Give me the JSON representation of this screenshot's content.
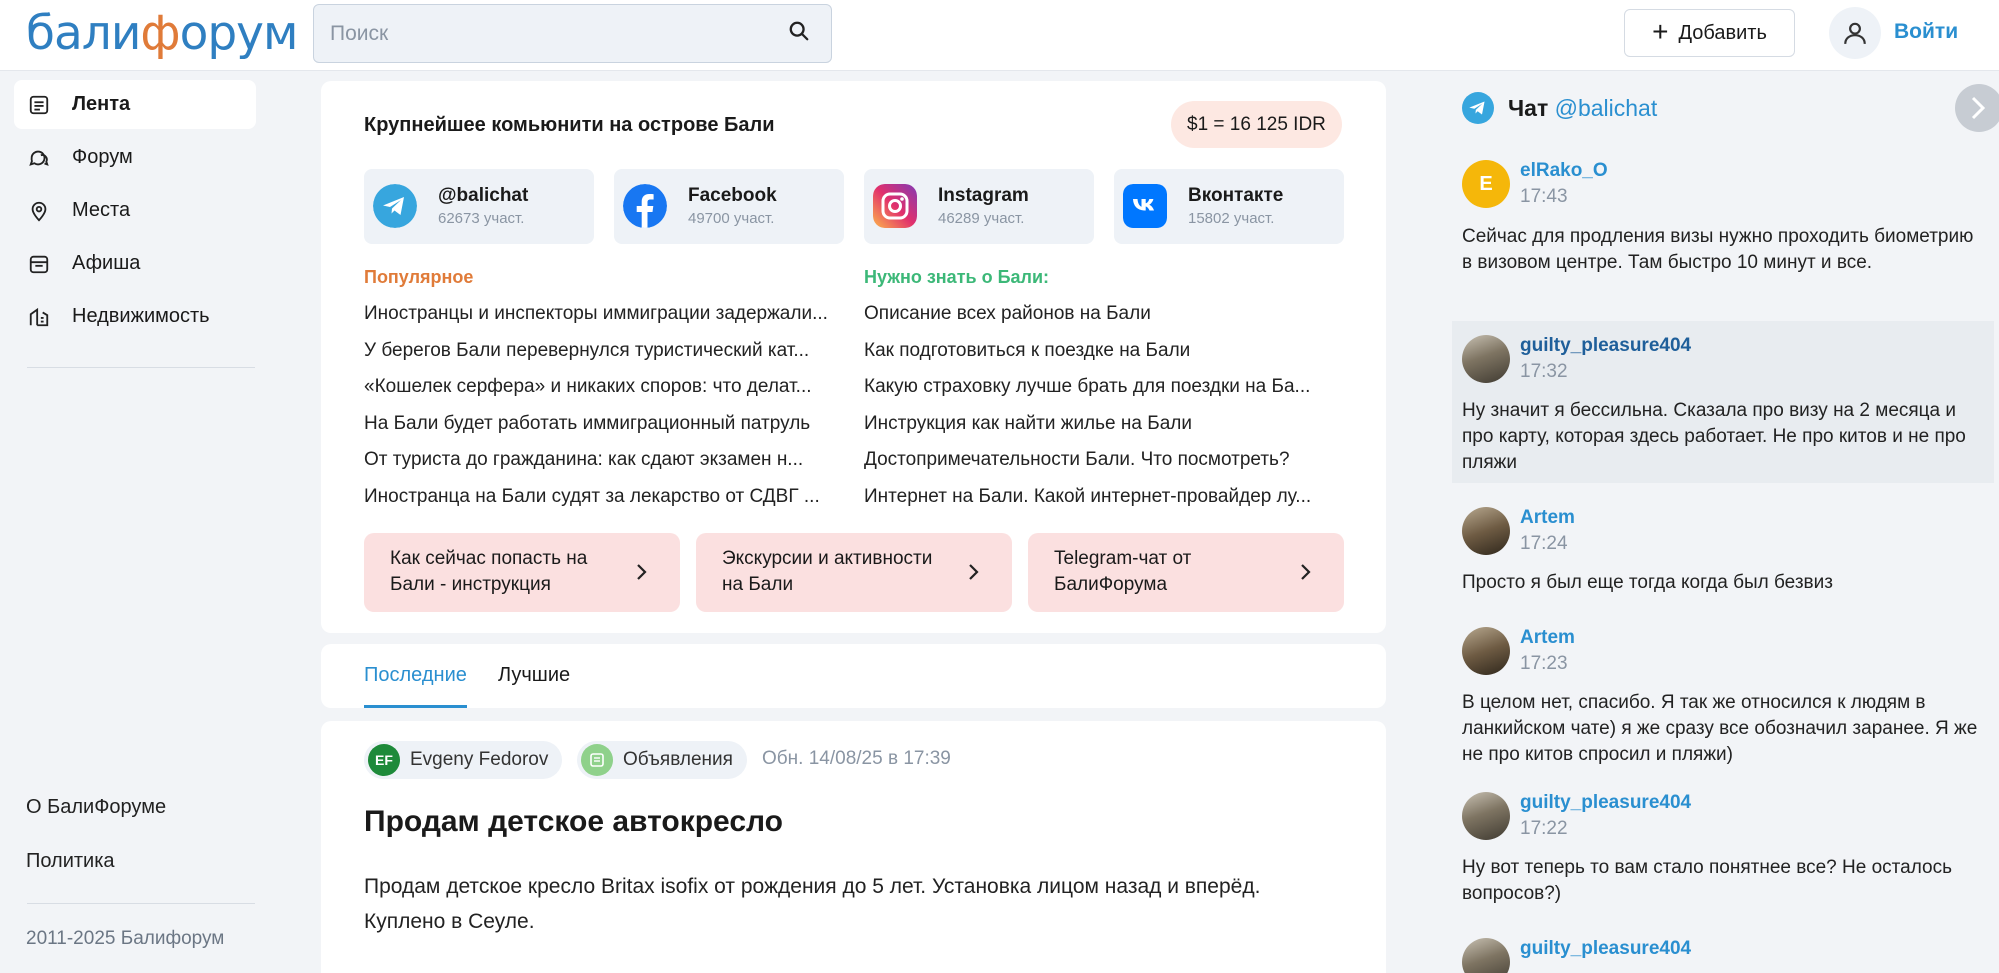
{
  "header": {
    "logo": {
      "part1": "бали",
      "part2": "ф",
      "part3": "орум"
    },
    "search_placeholder": "Поиск",
    "add_label": "Добавить",
    "login_label": "Войти"
  },
  "sidebar": {
    "items": [
      {
        "label": "Лента",
        "icon": "feed-icon",
        "active": true
      },
      {
        "label": "Форум",
        "icon": "chat-bubbles-icon"
      },
      {
        "label": "Места",
        "icon": "map-pin-icon"
      },
      {
        "label": "Афиша",
        "icon": "calendar-icon"
      },
      {
        "label": "Недвижимость",
        "icon": "building-icon"
      }
    ],
    "about": "О БалиФоруме",
    "policy": "Политика",
    "copyright": "2011-2025 Балифорум"
  },
  "community": {
    "title": "Крупнейшее комьюнити на острове Бали",
    "rate": "$1 = 16 125 IDR",
    "socials": [
      {
        "name": "@balichat",
        "count": "62673 участ.",
        "icon": "telegram-icon",
        "color": "#37a6de"
      },
      {
        "name": "Facebook",
        "count": "49700 участ.",
        "icon": "facebook-icon",
        "color": "#1877f2"
      },
      {
        "name": "Instagram",
        "count": "46289 участ.",
        "icon": "instagram-icon",
        "color": "#d6249f"
      },
      {
        "name": "Вконтакте",
        "count": "15802 участ.",
        "icon": "vk-icon",
        "color": "#0077ff"
      }
    ],
    "popular_title": "Популярное",
    "popular": [
      "Иностранцы и инспекторы иммиграции задержали...",
      "У берегов Бали перевернулся туристический кат...",
      "«Кошелек серфера» и никаких споров: что делат...",
      "На Бали будет работать иммиграционный патруль",
      "От туриста до гражданина: как сдают экзамен н...",
      "Иностранца на Бали судят за лекарство от СДВГ ..."
    ],
    "know_title": "Нужно знать о Бали:",
    "know": [
      "Описание всех районов на Бали",
      "Как подготовиться к поездке на Бали",
      "Какую страховку лучше брать для поездки на Ба...",
      "Инструкция как найти жилье на Бали",
      "Достопримечательности Бали. Что посмотреть?",
      "Интернет на Бали. Какой интернет-провайдер лу..."
    ],
    "promos": [
      "Как сейчас попасть на Бали - инструкция",
      "Экскурсии и активности на Бали",
      "Telegram-чат от БалиФорума"
    ]
  },
  "tabs": {
    "latest": "Последние",
    "best": "Лучшие"
  },
  "post": {
    "author_initials": "EF",
    "author": "Evgeny Fedorov",
    "category": "Объявления",
    "updated": "Обн. 14/08/25 в 17:39",
    "title": "Продам детское автокресло",
    "body": "Продам детское кресло Britax isofix от рождения до 5 лет. Установка лицом назад и вперёд. Куплено в Сеуле."
  },
  "chat": {
    "title": "Чат",
    "handle": "@balichat",
    "messages": [
      {
        "user": "elRako_O",
        "initial": "E",
        "time": "17:43",
        "text": "Сейчас для продления визы нужно проходить биометрию в визовом центре. Там быстро 10 минут и все."
      },
      {
        "user": "guilty_pleasure404",
        "time": "17:32",
        "text": "Ну значит я бессильна. Сказала про визу на 2 месяца и про карту, которая здесь работает. Не про китов и не про пляжи"
      },
      {
        "user": "Artem",
        "time": "17:24",
        "text": "Просто я был еще тогда когда был безвиз"
      },
      {
        "user": "Artem",
        "time": "17:23",
        "text": "В целом нет, спасибо. Я так же относился к людям в ланкийском чате) я же сразу все обозначил заранее. Я же не про китов спросил и пляжи)"
      },
      {
        "user": "guilty_pleasure404",
        "time": "17:22",
        "text": "Ну вот теперь то вам стало понятнее все? Не осталось вопросов?)"
      },
      {
        "user": "guilty_pleasure404"
      }
    ]
  }
}
